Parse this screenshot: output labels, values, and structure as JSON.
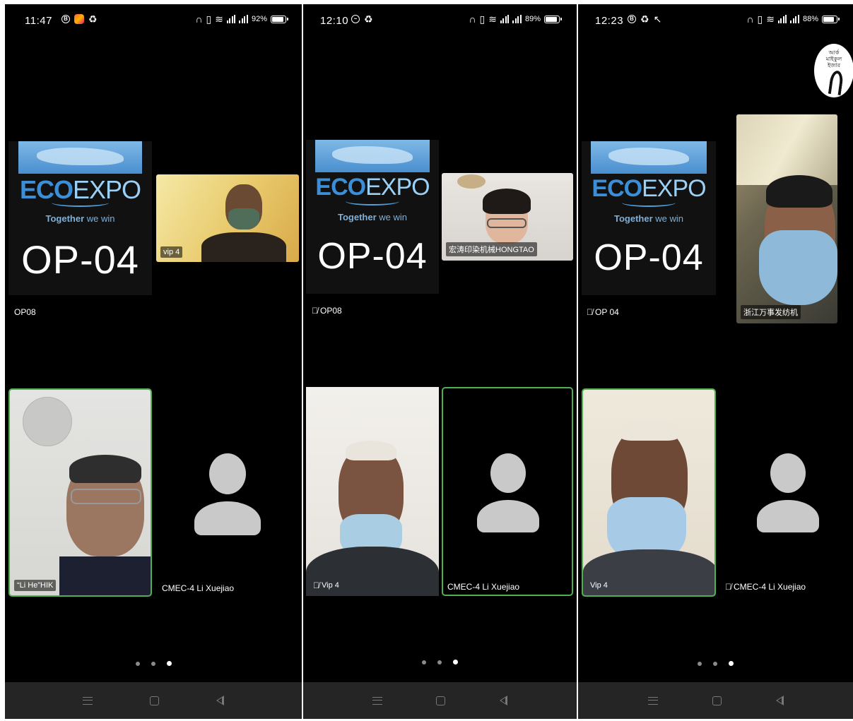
{
  "panels": [
    {
      "status": {
        "time": "11:47",
        "battery": "92%",
        "battery_level": 0.92
      },
      "tiles": {
        "logo": {
          "brand_a": "ECO",
          "brand_b": "EXPO",
          "tag_a": "Together",
          "tag_b": " we win",
          "code": "OP-04",
          "name": "OP08",
          "muted": false
        },
        "top_right": {
          "name": "vip 4"
        },
        "bottom_left": {
          "name": "“Li He”HIK"
        },
        "bottom_right": {
          "name": "CMEC-4 Li Xuejiao",
          "muted": false
        }
      }
    },
    {
      "status": {
        "time": "12:10",
        "battery": "89%",
        "battery_level": 0.89
      },
      "tiles": {
        "logo": {
          "brand_a": "ECO",
          "brand_b": "EXPO",
          "tag_a": "Together",
          "tag_b": " we win",
          "code": "OP-04",
          "name": "OP08",
          "muted": true
        },
        "top_right": {
          "name": "宏涛印染机械HONGTAO"
        },
        "bottom_left": {
          "name": "Vip 4",
          "muted": true
        },
        "bottom_right": {
          "name": "CMEC-4 Li Xuejiao"
        }
      }
    },
    {
      "status": {
        "time": "12:23",
        "battery": "88%",
        "battery_level": 0.88
      },
      "overlay_badge": {
        "text": "আর্ক মাইকুল ইজার"
      },
      "tiles": {
        "logo": {
          "brand_a": "ECO",
          "brand_b": "EXPO",
          "tag_a": "Together",
          "tag_b": " we win",
          "code": "OP-04",
          "name": "OP 04",
          "muted": true
        },
        "top_right": {
          "name": "浙江万事发纺机"
        },
        "bottom_left": {
          "name": "Vip 4"
        },
        "bottom_right": {
          "name": "CMEC-4 Li Xuejiao",
          "muted": true
        }
      }
    }
  ],
  "pager": {
    "pages": 3,
    "current": 3
  },
  "colors": {
    "active_speaker_border": "#4fb050",
    "background": "#000000",
    "navbar": "#252525"
  },
  "icons": [
    "headphone-icon",
    "vibrate-icon",
    "wifi-icon",
    "signal-icon",
    "battery-icon",
    "mic-muted-icon",
    "menu-nav-icon",
    "home-nav-icon",
    "back-nav-icon"
  ]
}
